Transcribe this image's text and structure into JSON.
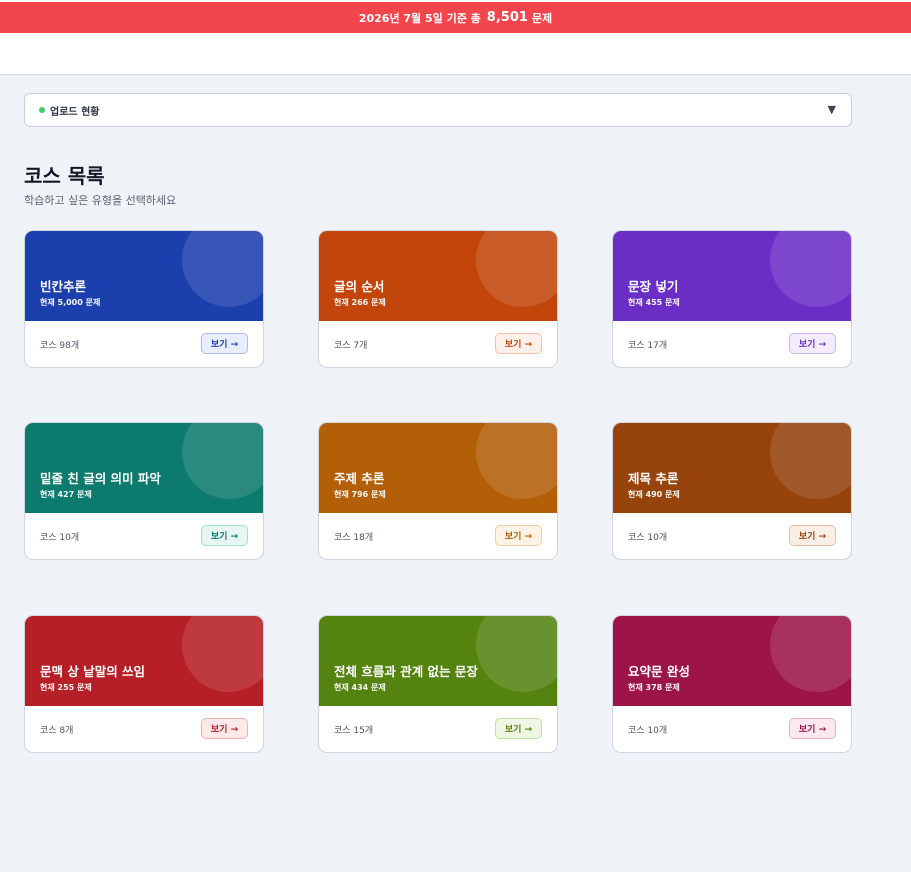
{
  "banner": {
    "prefix": "2026년 7월 5일 기준 총",
    "count": "8,501",
    "suffix": "문제"
  },
  "upload": {
    "label": "업로드 현황",
    "caret": "▼"
  },
  "section": {
    "title": "코스 목록",
    "subtitle": "학습하고 싶은 유형을 선택하세요"
  },
  "cards": [
    {
      "title": "빈칸추론",
      "count": "현재 5,000 문제",
      "courses": "코스 98개",
      "button": "보기 →",
      "color": "#1c3fae",
      "btn_bg": "#e8eeff",
      "btn_fg": "#1c3fae",
      "btn_border": "#a9bcf0"
    },
    {
      "title": "글의 순서",
      "count": "현재 266 문제",
      "courses": "코스 7개",
      "button": "보기 →",
      "color": "#c2450c",
      "btn_bg": "#fff1ea",
      "btn_fg": "#c2450c",
      "btn_border": "#f3c0a6"
    },
    {
      "title": "문장 넣기",
      "count": "현재 455 문제",
      "courses": "코스 17개",
      "button": "보기 →",
      "color": "#6a2ec7",
      "btn_bg": "#f3ecff",
      "btn_fg": "#6a2ec7",
      "btn_border": "#cdb7f0"
    },
    {
      "title": "밑줄 친 글의 의미 파악",
      "count": "현재 427 문제",
      "courses": "코스 10개",
      "button": "보기 →",
      "color": "#0d7a6e",
      "btn_bg": "#e5f6f3",
      "btn_fg": "#0d7a6e",
      "btn_border": "#a8ddd4"
    },
    {
      "title": "주제 추론",
      "count": "현재 796 문제",
      "courses": "코스 18개",
      "button": "보기 →",
      "color": "#b35f08",
      "btn_bg": "#fff3e5",
      "btn_fg": "#b35f08",
      "btn_border": "#efcb9e"
    },
    {
      "title": "제목 추론",
      "count": "현재 490 문제",
      "courses": "코스 10개",
      "button": "보기 →",
      "color": "#96430c",
      "btn_bg": "#fbefe5",
      "btn_fg": "#96430c",
      "btn_border": "#e2bfa4"
    },
    {
      "title": "문맥 상 낱말의 쓰임",
      "count": "현재 255 문제",
      "courses": "코스 8개",
      "button": "보기 →",
      "color": "#b61f25",
      "btn_bg": "#fde9e9",
      "btn_fg": "#b61f25",
      "btn_border": "#efb0b2"
    },
    {
      "title": "전체 흐름과 관계 없는 문장",
      "count": "현재 434 문제",
      "courses": "코스 15개",
      "button": "보기 →",
      "color": "#548310",
      "btn_bg": "#eff6e4",
      "btn_fg": "#548310",
      "btn_border": "#c4dca2"
    },
    {
      "title": "요약문 완성",
      "count": "현재 378 문제",
      "courses": "코스 10개",
      "button": "보기 →",
      "color": "#9d1548",
      "btn_bg": "#fce8ef",
      "btn_fg": "#9d1548",
      "btn_border": "#ebaec4"
    }
  ]
}
